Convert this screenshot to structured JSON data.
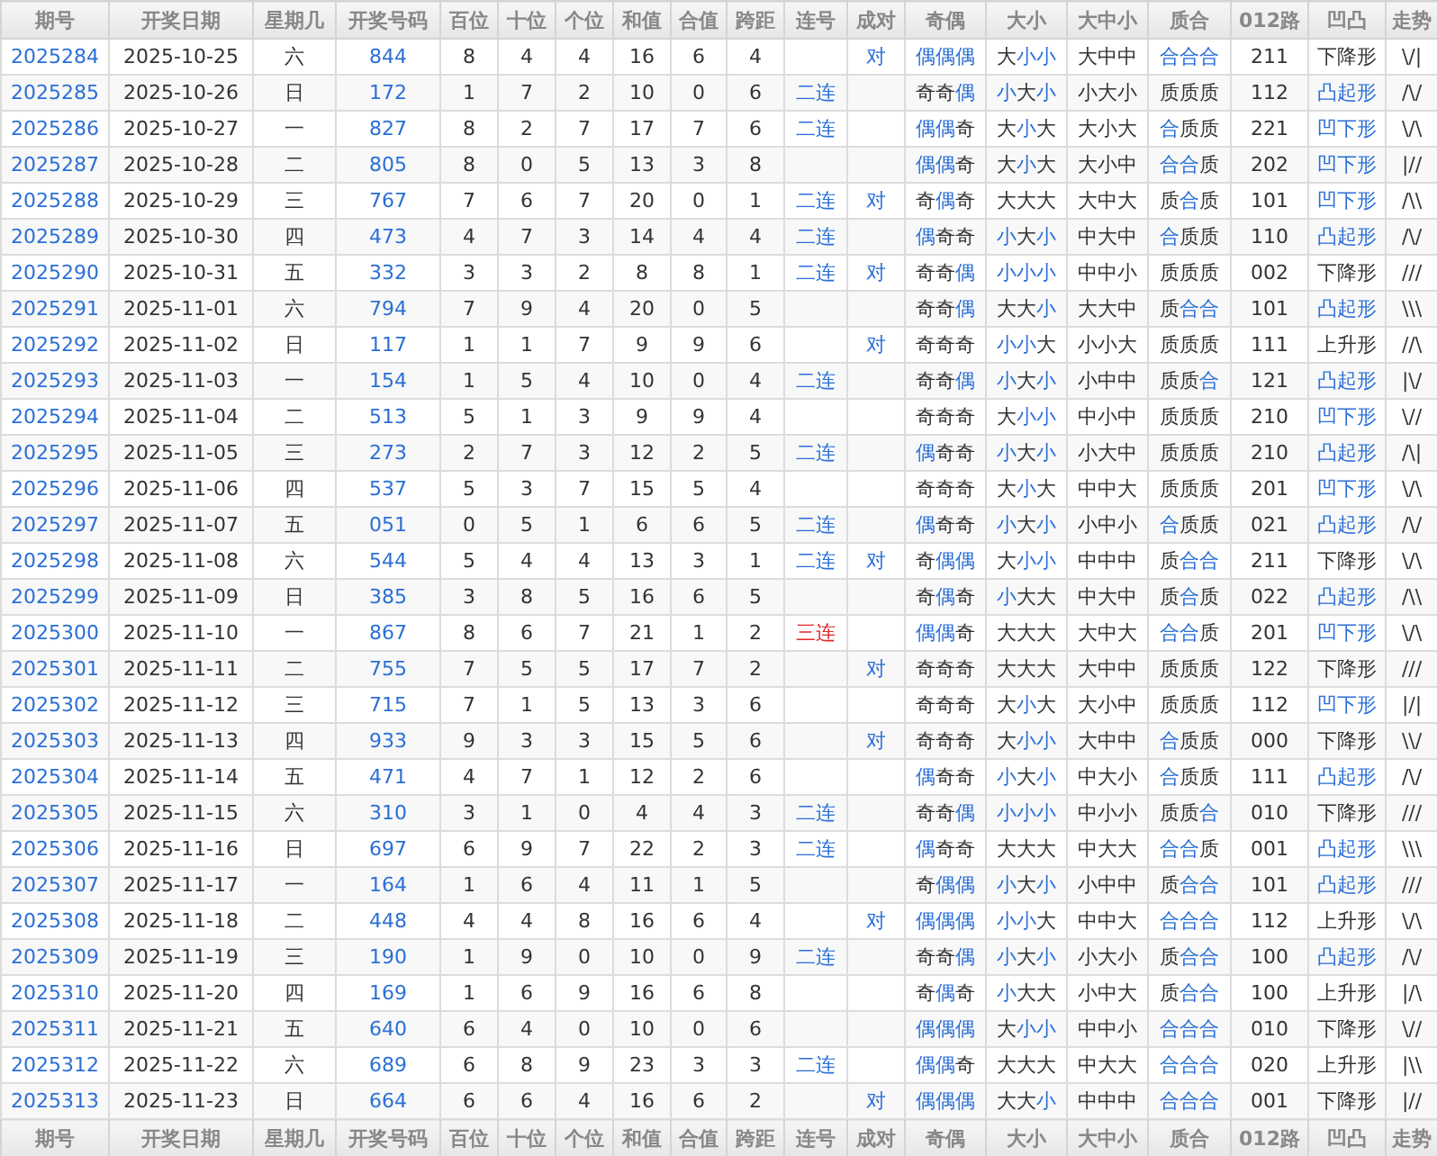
{
  "columns": [
    "期号",
    "开奖日期",
    "星期几",
    "开奖号码",
    "百位",
    "十位",
    "个位",
    "和值",
    "合值",
    "跨距",
    "连号",
    "成对",
    "奇偶",
    "大小",
    "大中小",
    "质合",
    "012路",
    "凹凸",
    "走势"
  ],
  "rows": [
    {
      "issue": "2025284",
      "date": "2025-10-25",
      "weekday": "六",
      "number": "844",
      "hundreds": "8",
      "tens": "4",
      "units": "4",
      "sum": "16",
      "sum_tail": "6",
      "span": "4",
      "pair": "对",
      "odd_even": {
        "text": "偶偶偶",
        "hl": [
          true,
          true,
          true
        ]
      },
      "big_small": {
        "text": "大小小",
        "hl": [
          false,
          true,
          true
        ]
      },
      "big_mid_small": "大中中",
      "prime_composite": {
        "text": "合合合",
        "hl": [
          true,
          true,
          true
        ]
      },
      "route": "211",
      "shape": {
        "text": "下降形",
        "hl": false
      },
      "trend": "\\/|"
    },
    {
      "issue": "2025285",
      "date": "2025-10-26",
      "weekday": "日",
      "number": "172",
      "hundreds": "1",
      "tens": "7",
      "units": "2",
      "sum": "10",
      "sum_tail": "0",
      "span": "6",
      "consecutive": {
        "text": "二连",
        "color": "#2a6fd6"
      },
      "odd_even": {
        "text": "奇奇偶",
        "hl": [
          false,
          false,
          true
        ]
      },
      "big_small": {
        "text": "小大小",
        "hl": [
          true,
          false,
          true
        ]
      },
      "big_mid_small": "小大小",
      "prime_composite": {
        "text": "质质质",
        "hl": [
          false,
          false,
          false
        ]
      },
      "route": "112",
      "shape": {
        "text": "凸起形",
        "hl": true
      },
      "trend": "/\\/"
    },
    {
      "issue": "2025286",
      "date": "2025-10-27",
      "weekday": "一",
      "number": "827",
      "hundreds": "8",
      "tens": "2",
      "units": "7",
      "sum": "17",
      "sum_tail": "7",
      "span": "6",
      "consecutive": {
        "text": "二连",
        "color": "#2a6fd6"
      },
      "odd_even": {
        "text": "偶偶奇",
        "hl": [
          true,
          true,
          false
        ]
      },
      "big_small": {
        "text": "大小大",
        "hl": [
          false,
          true,
          false
        ]
      },
      "big_mid_small": "大小大",
      "prime_composite": {
        "text": "合质质",
        "hl": [
          true,
          false,
          false
        ]
      },
      "route": "221",
      "shape": {
        "text": "凹下形",
        "hl": true
      },
      "trend": "\\/\\"
    },
    {
      "issue": "2025287",
      "date": "2025-10-28",
      "weekday": "二",
      "number": "805",
      "hundreds": "8",
      "tens": "0",
      "units": "5",
      "sum": "13",
      "sum_tail": "3",
      "span": "8",
      "odd_even": {
        "text": "偶偶奇",
        "hl": [
          true,
          true,
          false
        ]
      },
      "big_small": {
        "text": "大小大",
        "hl": [
          false,
          true,
          false
        ]
      },
      "big_mid_small": "大小中",
      "prime_composite": {
        "text": "合合质",
        "hl": [
          true,
          true,
          false
        ]
      },
      "route": "202",
      "shape": {
        "text": "凹下形",
        "hl": true
      },
      "trend": "|//"
    },
    {
      "issue": "2025288",
      "date": "2025-10-29",
      "weekday": "三",
      "number": "767",
      "hundreds": "7",
      "tens": "6",
      "units": "7",
      "sum": "20",
      "sum_tail": "0",
      "span": "1",
      "consecutive": {
        "text": "二连",
        "color": "#2a6fd6"
      },
      "pair": "对",
      "odd_even": {
        "text": "奇偶奇",
        "hl": [
          false,
          true,
          false
        ]
      },
      "big_small": {
        "text": "大大大",
        "hl": [
          false,
          false,
          false
        ]
      },
      "big_mid_small": "大中大",
      "prime_composite": {
        "text": "质合质",
        "hl": [
          false,
          true,
          false
        ]
      },
      "route": "101",
      "shape": {
        "text": "凹下形",
        "hl": true
      },
      "trend": "/\\\\"
    },
    {
      "issue": "2025289",
      "date": "2025-10-30",
      "weekday": "四",
      "number": "473",
      "hundreds": "4",
      "tens": "7",
      "units": "3",
      "sum": "14",
      "sum_tail": "4",
      "span": "4",
      "consecutive": {
        "text": "二连",
        "color": "#2a6fd6"
      },
      "odd_even": {
        "text": "偶奇奇",
        "hl": [
          true,
          false,
          false
        ]
      },
      "big_small": {
        "text": "小大小",
        "hl": [
          true,
          false,
          true
        ]
      },
      "big_mid_small": "中大中",
      "prime_composite": {
        "text": "合质质",
        "hl": [
          true,
          false,
          false
        ]
      },
      "route": "110",
      "shape": {
        "text": "凸起形",
        "hl": true
      },
      "trend": "/\\/"
    },
    {
      "issue": "2025290",
      "date": "2025-10-31",
      "weekday": "五",
      "number": "332",
      "hundreds": "3",
      "tens": "3",
      "units": "2",
      "sum": "8",
      "sum_tail": "8",
      "span": "1",
      "consecutive": {
        "text": "二连",
        "color": "#2a6fd6"
      },
      "pair": "对",
      "odd_even": {
        "text": "奇奇偶",
        "hl": [
          false,
          false,
          true
        ]
      },
      "big_small": {
        "text": "小小小",
        "hl": [
          true,
          true,
          true
        ]
      },
      "big_mid_small": "中中小",
      "prime_composite": {
        "text": "质质质",
        "hl": [
          false,
          false,
          false
        ]
      },
      "route": "002",
      "shape": {
        "text": "下降形",
        "hl": false
      },
      "trend": "///"
    },
    {
      "issue": "2025291",
      "date": "2025-11-01",
      "weekday": "六",
      "number": "794",
      "hundreds": "7",
      "tens": "9",
      "units": "4",
      "sum": "20",
      "sum_tail": "0",
      "span": "5",
      "odd_even": {
        "text": "奇奇偶",
        "hl": [
          false,
          false,
          true
        ]
      },
      "big_small": {
        "text": "大大小",
        "hl": [
          false,
          false,
          true
        ]
      },
      "big_mid_small": "大大中",
      "prime_composite": {
        "text": "质合合",
        "hl": [
          false,
          true,
          true
        ]
      },
      "route": "101",
      "shape": {
        "text": "凸起形",
        "hl": true
      },
      "trend": "\\\\\\"
    },
    {
      "issue": "2025292",
      "date": "2025-11-02",
      "weekday": "日",
      "number": "117",
      "hundreds": "1",
      "tens": "1",
      "units": "7",
      "sum": "9",
      "sum_tail": "9",
      "span": "6",
      "pair": "对",
      "odd_even": {
        "text": "奇奇奇",
        "hl": [
          false,
          false,
          false
        ]
      },
      "big_small": {
        "text": "小小大",
        "hl": [
          true,
          true,
          false
        ]
      },
      "big_mid_small": "小小大",
      "prime_composite": {
        "text": "质质质",
        "hl": [
          false,
          false,
          false
        ]
      },
      "route": "111",
      "shape": {
        "text": "上升形",
        "hl": false
      },
      "trend": "//\\"
    },
    {
      "issue": "2025293",
      "date": "2025-11-03",
      "weekday": "一",
      "number": "154",
      "hundreds": "1",
      "tens": "5",
      "units": "4",
      "sum": "10",
      "sum_tail": "0",
      "span": "4",
      "consecutive": {
        "text": "二连",
        "color": "#2a6fd6"
      },
      "odd_even": {
        "text": "奇奇偶",
        "hl": [
          false,
          false,
          true
        ]
      },
      "big_small": {
        "text": "小大小",
        "hl": [
          true,
          false,
          true
        ]
      },
      "big_mid_small": "小中中",
      "prime_composite": {
        "text": "质质合",
        "hl": [
          false,
          false,
          true
        ]
      },
      "route": "121",
      "shape": {
        "text": "凸起形",
        "hl": true
      },
      "trend": "|\\/"
    },
    {
      "issue": "2025294",
      "date": "2025-11-04",
      "weekday": "二",
      "number": "513",
      "hundreds": "5",
      "tens": "1",
      "units": "3",
      "sum": "9",
      "sum_tail": "9",
      "span": "4",
      "odd_even": {
        "text": "奇奇奇",
        "hl": [
          false,
          false,
          false
        ]
      },
      "big_small": {
        "text": "大小小",
        "hl": [
          false,
          true,
          true
        ]
      },
      "big_mid_small": "中小中",
      "prime_composite": {
        "text": "质质质",
        "hl": [
          false,
          false,
          false
        ]
      },
      "route": "210",
      "shape": {
        "text": "凹下形",
        "hl": true
      },
      "trend": "\\//"
    },
    {
      "issue": "2025295",
      "date": "2025-11-05",
      "weekday": "三",
      "number": "273",
      "hundreds": "2",
      "tens": "7",
      "units": "3",
      "sum": "12",
      "sum_tail": "2",
      "span": "5",
      "consecutive": {
        "text": "二连",
        "color": "#2a6fd6"
      },
      "odd_even": {
        "text": "偶奇奇",
        "hl": [
          true,
          false,
          false
        ]
      },
      "big_small": {
        "text": "小大小",
        "hl": [
          true,
          false,
          true
        ]
      },
      "big_mid_small": "小大中",
      "prime_composite": {
        "text": "质质质",
        "hl": [
          false,
          false,
          false
        ]
      },
      "route": "210",
      "shape": {
        "text": "凸起形",
        "hl": true
      },
      "trend": "/\\|"
    },
    {
      "issue": "2025296",
      "date": "2025-11-06",
      "weekday": "四",
      "number": "537",
      "hundreds": "5",
      "tens": "3",
      "units": "7",
      "sum": "15",
      "sum_tail": "5",
      "span": "4",
      "odd_even": {
        "text": "奇奇奇",
        "hl": [
          false,
          false,
          false
        ]
      },
      "big_small": {
        "text": "大小大",
        "hl": [
          false,
          true,
          false
        ]
      },
      "big_mid_small": "中中大",
      "prime_composite": {
        "text": "质质质",
        "hl": [
          false,
          false,
          false
        ]
      },
      "route": "201",
      "shape": {
        "text": "凹下形",
        "hl": true
      },
      "trend": "\\/\\"
    },
    {
      "issue": "2025297",
      "date": "2025-11-07",
      "weekday": "五",
      "number": "051",
      "hundreds": "0",
      "tens": "5",
      "units": "1",
      "sum": "6",
      "sum_tail": "6",
      "span": "5",
      "consecutive": {
        "text": "二连",
        "color": "#2a6fd6"
      },
      "odd_even": {
        "text": "偶奇奇",
        "hl": [
          true,
          false,
          false
        ]
      },
      "big_small": {
        "text": "小大小",
        "hl": [
          true,
          false,
          true
        ]
      },
      "big_mid_small": "小中小",
      "prime_composite": {
        "text": "合质质",
        "hl": [
          true,
          false,
          false
        ]
      },
      "route": "021",
      "shape": {
        "text": "凸起形",
        "hl": true
      },
      "trend": "/\\/"
    },
    {
      "issue": "2025298",
      "date": "2025-11-08",
      "weekday": "六",
      "number": "544",
      "hundreds": "5",
      "tens": "4",
      "units": "4",
      "sum": "13",
      "sum_tail": "3",
      "span": "1",
      "consecutive": {
        "text": "二连",
        "color": "#2a6fd6"
      },
      "pair": "对",
      "odd_even": {
        "text": "奇偶偶",
        "hl": [
          false,
          true,
          true
        ]
      },
      "big_small": {
        "text": "大小小",
        "hl": [
          false,
          true,
          true
        ]
      },
      "big_mid_small": "中中中",
      "prime_composite": {
        "text": "质合合",
        "hl": [
          false,
          true,
          true
        ]
      },
      "route": "211",
      "shape": {
        "text": "下降形",
        "hl": false
      },
      "trend": "\\/\\"
    },
    {
      "issue": "2025299",
      "date": "2025-11-09",
      "weekday": "日",
      "number": "385",
      "hundreds": "3",
      "tens": "8",
      "units": "5",
      "sum": "16",
      "sum_tail": "6",
      "span": "5",
      "odd_even": {
        "text": "奇偶奇",
        "hl": [
          false,
          true,
          false
        ]
      },
      "big_small": {
        "text": "小大大",
        "hl": [
          true,
          false,
          false
        ]
      },
      "big_mid_small": "中大中",
      "prime_composite": {
        "text": "质合质",
        "hl": [
          false,
          true,
          false
        ]
      },
      "route": "022",
      "shape": {
        "text": "凸起形",
        "hl": true
      },
      "trend": "/\\\\"
    },
    {
      "issue": "2025300",
      "date": "2025-11-10",
      "weekday": "一",
      "number": "867",
      "hundreds": "8",
      "tens": "6",
      "units": "7",
      "sum": "21",
      "sum_tail": "1",
      "span": "2",
      "consecutive": {
        "text": "三连",
        "color": "#e02828"
      },
      "odd_even": {
        "text": "偶偶奇",
        "hl": [
          true,
          true,
          false
        ]
      },
      "big_small": {
        "text": "大大大",
        "hl": [
          false,
          false,
          false
        ]
      },
      "big_mid_small": "大中大",
      "prime_composite": {
        "text": "合合质",
        "hl": [
          true,
          true,
          false
        ]
      },
      "route": "201",
      "shape": {
        "text": "凹下形",
        "hl": true
      },
      "trend": "\\/\\"
    },
    {
      "issue": "2025301",
      "date": "2025-11-11",
      "weekday": "二",
      "number": "755",
      "hundreds": "7",
      "tens": "5",
      "units": "5",
      "sum": "17",
      "sum_tail": "7",
      "span": "2",
      "pair": "对",
      "odd_even": {
        "text": "奇奇奇",
        "hl": [
          false,
          false,
          false
        ]
      },
      "big_small": {
        "text": "大大大",
        "hl": [
          false,
          false,
          false
        ]
      },
      "big_mid_small": "大中中",
      "prime_composite": {
        "text": "质质质",
        "hl": [
          false,
          false,
          false
        ]
      },
      "route": "122",
      "shape": {
        "text": "下降形",
        "hl": false
      },
      "trend": "///"
    },
    {
      "issue": "2025302",
      "date": "2025-11-12",
      "weekday": "三",
      "number": "715",
      "hundreds": "7",
      "tens": "1",
      "units": "5",
      "sum": "13",
      "sum_tail": "3",
      "span": "6",
      "odd_even": {
        "text": "奇奇奇",
        "hl": [
          false,
          false,
          false
        ]
      },
      "big_small": {
        "text": "大小大",
        "hl": [
          false,
          true,
          false
        ]
      },
      "big_mid_small": "大小中",
      "prime_composite": {
        "text": "质质质",
        "hl": [
          false,
          false,
          false
        ]
      },
      "route": "112",
      "shape": {
        "text": "凹下形",
        "hl": true
      },
      "trend": "|/|"
    },
    {
      "issue": "2025303",
      "date": "2025-11-13",
      "weekday": "四",
      "number": "933",
      "hundreds": "9",
      "tens": "3",
      "units": "3",
      "sum": "15",
      "sum_tail": "5",
      "span": "6",
      "pair": "对",
      "odd_even": {
        "text": "奇奇奇",
        "hl": [
          false,
          false,
          false
        ]
      },
      "big_small": {
        "text": "大小小",
        "hl": [
          false,
          true,
          true
        ]
      },
      "big_mid_small": "大中中",
      "prime_composite": {
        "text": "合质质",
        "hl": [
          true,
          false,
          false
        ]
      },
      "route": "000",
      "shape": {
        "text": "下降形",
        "hl": false
      },
      "trend": "\\\\/"
    },
    {
      "issue": "2025304",
      "date": "2025-11-14",
      "weekday": "五",
      "number": "471",
      "hundreds": "4",
      "tens": "7",
      "units": "1",
      "sum": "12",
      "sum_tail": "2",
      "span": "6",
      "odd_even": {
        "text": "偶奇奇",
        "hl": [
          true,
          false,
          false
        ]
      },
      "big_small": {
        "text": "小大小",
        "hl": [
          true,
          false,
          true
        ]
      },
      "big_mid_small": "中大小",
      "prime_composite": {
        "text": "合质质",
        "hl": [
          true,
          false,
          false
        ]
      },
      "route": "111",
      "shape": {
        "text": "凸起形",
        "hl": true
      },
      "trend": "/\\/"
    },
    {
      "issue": "2025305",
      "date": "2025-11-15",
      "weekday": "六",
      "number": "310",
      "hundreds": "3",
      "tens": "1",
      "units": "0",
      "sum": "4",
      "sum_tail": "4",
      "span": "3",
      "consecutive": {
        "text": "二连",
        "color": "#2a6fd6"
      },
      "odd_even": {
        "text": "奇奇偶",
        "hl": [
          false,
          false,
          true
        ]
      },
      "big_small": {
        "text": "小小小",
        "hl": [
          true,
          true,
          true
        ]
      },
      "big_mid_small": "中小小",
      "prime_composite": {
        "text": "质质合",
        "hl": [
          false,
          false,
          true
        ]
      },
      "route": "010",
      "shape": {
        "text": "下降形",
        "hl": false
      },
      "trend": "///"
    },
    {
      "issue": "2025306",
      "date": "2025-11-16",
      "weekday": "日",
      "number": "697",
      "hundreds": "6",
      "tens": "9",
      "units": "7",
      "sum": "22",
      "sum_tail": "2",
      "span": "3",
      "consecutive": {
        "text": "二连",
        "color": "#2a6fd6"
      },
      "odd_even": {
        "text": "偶奇奇",
        "hl": [
          true,
          false,
          false
        ]
      },
      "big_small": {
        "text": "大大大",
        "hl": [
          false,
          false,
          false
        ]
      },
      "big_mid_small": "中大大",
      "prime_composite": {
        "text": "合合质",
        "hl": [
          true,
          true,
          false
        ]
      },
      "route": "001",
      "shape": {
        "text": "凸起形",
        "hl": true
      },
      "trend": "\\\\\\"
    },
    {
      "issue": "2025307",
      "date": "2025-11-17",
      "weekday": "一",
      "number": "164",
      "hundreds": "1",
      "tens": "6",
      "units": "4",
      "sum": "11",
      "sum_tail": "1",
      "span": "5",
      "odd_even": {
        "text": "奇偶偶",
        "hl": [
          false,
          true,
          true
        ]
      },
      "big_small": {
        "text": "小大小",
        "hl": [
          true,
          false,
          true
        ]
      },
      "big_mid_small": "小中中",
      "prime_composite": {
        "text": "质合合",
        "hl": [
          false,
          true,
          true
        ]
      },
      "route": "101",
      "shape": {
        "text": "凸起形",
        "hl": true
      },
      "trend": "///"
    },
    {
      "issue": "2025308",
      "date": "2025-11-18",
      "weekday": "二",
      "number": "448",
      "hundreds": "4",
      "tens": "4",
      "units": "8",
      "sum": "16",
      "sum_tail": "6",
      "span": "4",
      "pair": "对",
      "odd_even": {
        "text": "偶偶偶",
        "hl": [
          true,
          true,
          true
        ]
      },
      "big_small": {
        "text": "小小大",
        "hl": [
          true,
          true,
          false
        ]
      },
      "big_mid_small": "中中大",
      "prime_composite": {
        "text": "合合合",
        "hl": [
          true,
          true,
          true
        ]
      },
      "route": "112",
      "shape": {
        "text": "上升形",
        "hl": false
      },
      "trend": "\\/\\"
    },
    {
      "issue": "2025309",
      "date": "2025-11-19",
      "weekday": "三",
      "number": "190",
      "hundreds": "1",
      "tens": "9",
      "units": "0",
      "sum": "10",
      "sum_tail": "0",
      "span": "9",
      "consecutive": {
        "text": "二连",
        "color": "#2a6fd6"
      },
      "odd_even": {
        "text": "奇奇偶",
        "hl": [
          false,
          false,
          true
        ]
      },
      "big_small": {
        "text": "小大小",
        "hl": [
          true,
          false,
          true
        ]
      },
      "big_mid_small": "小大小",
      "prime_composite": {
        "text": "质合合",
        "hl": [
          false,
          true,
          true
        ]
      },
      "route": "100",
      "shape": {
        "text": "凸起形",
        "hl": true
      },
      "trend": "/\\/"
    },
    {
      "issue": "2025310",
      "date": "2025-11-20",
      "weekday": "四",
      "number": "169",
      "hundreds": "1",
      "tens": "6",
      "units": "9",
      "sum": "16",
      "sum_tail": "6",
      "span": "8",
      "odd_even": {
        "text": "奇偶奇",
        "hl": [
          false,
          true,
          false
        ]
      },
      "big_small": {
        "text": "小大大",
        "hl": [
          true,
          false,
          false
        ]
      },
      "big_mid_small": "小中大",
      "prime_composite": {
        "text": "质合合",
        "hl": [
          false,
          true,
          true
        ]
      },
      "route": "100",
      "shape": {
        "text": "上升形",
        "hl": false
      },
      "trend": "|/\\"
    },
    {
      "issue": "2025311",
      "date": "2025-11-21",
      "weekday": "五",
      "number": "640",
      "hundreds": "6",
      "tens": "4",
      "units": "0",
      "sum": "10",
      "sum_tail": "0",
      "span": "6",
      "odd_even": {
        "text": "偶偶偶",
        "hl": [
          true,
          true,
          true
        ]
      },
      "big_small": {
        "text": "大小小",
        "hl": [
          false,
          true,
          true
        ]
      },
      "big_mid_small": "中中小",
      "prime_composite": {
        "text": "合合合",
        "hl": [
          true,
          true,
          true
        ]
      },
      "route": "010",
      "shape": {
        "text": "下降形",
        "hl": false
      },
      "trend": "\\//"
    },
    {
      "issue": "2025312",
      "date": "2025-11-22",
      "weekday": "六",
      "number": "689",
      "hundreds": "6",
      "tens": "8",
      "units": "9",
      "sum": "23",
      "sum_tail": "3",
      "span": "3",
      "consecutive": {
        "text": "二连",
        "color": "#2a6fd6"
      },
      "odd_even": {
        "text": "偶偶奇",
        "hl": [
          true,
          true,
          false
        ]
      },
      "big_small": {
        "text": "大大大",
        "hl": [
          false,
          false,
          false
        ]
      },
      "big_mid_small": "中大大",
      "prime_composite": {
        "text": "合合合",
        "hl": [
          true,
          true,
          true
        ]
      },
      "route": "020",
      "shape": {
        "text": "上升形",
        "hl": false
      },
      "trend": "|\\\\"
    },
    {
      "issue": "2025313",
      "date": "2025-11-23",
      "weekday": "日",
      "number": "664",
      "hundreds": "6",
      "tens": "6",
      "units": "4",
      "sum": "16",
      "sum_tail": "6",
      "span": "2",
      "pair": "对",
      "odd_even": {
        "text": "偶偶偶",
        "hl": [
          true,
          true,
          true
        ]
      },
      "big_small": {
        "text": "大大小",
        "hl": [
          false,
          false,
          true
        ]
      },
      "big_mid_small": "中中中",
      "prime_composite": {
        "text": "合合合",
        "hl": [
          true,
          true,
          true
        ]
      },
      "route": "001",
      "shape": {
        "text": "下降形",
        "hl": false
      },
      "trend": "|//"
    }
  ],
  "footer_columns": [
    "期号",
    "开奖日期",
    "星期几",
    "开奖号码",
    "百位",
    "十位",
    "个位",
    "和值",
    "合值",
    "跨距",
    "连号",
    "成对",
    "奇偶",
    "大小",
    "大中小",
    "质合",
    "012路",
    "凹凸",
    "走势"
  ]
}
